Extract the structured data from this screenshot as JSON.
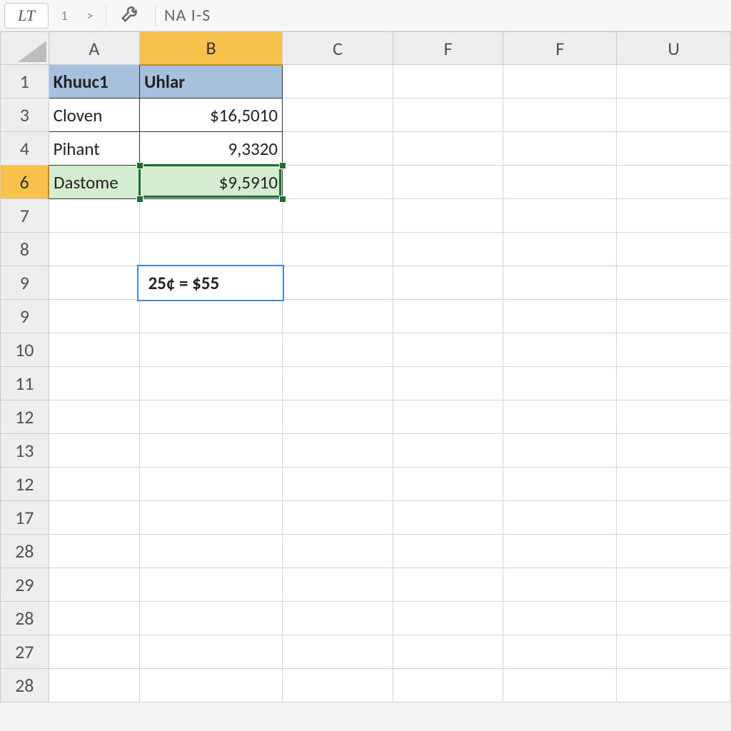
{
  "toolbar": {
    "name_box": "LT",
    "nav_prev": "1",
    "nav_next": ">",
    "fx_icon": "wrench-icon",
    "formula_bar": "NA I-S"
  },
  "columns": [
    "A",
    "B",
    "C",
    "F",
    "F",
    "U"
  ],
  "active_column_index": 1,
  "row_labels": [
    "1",
    "3",
    "4",
    "6",
    "7",
    "8",
    "9",
    "9",
    "10",
    "11",
    "12",
    "13",
    "12",
    "17",
    "28",
    "29",
    "28",
    "27",
    "28"
  ],
  "active_row_index": 3,
  "cells": {
    "A1": "Khuuc1",
    "B1": "Uhlar",
    "A3": "Cloven",
    "B3": "$16,5010",
    "A4": "Pihant",
    "B4": "9,3320",
    "A6": "Dastome",
    "B6": "$9,5910"
  },
  "float_box": {
    "text": "25¢ = $55"
  }
}
